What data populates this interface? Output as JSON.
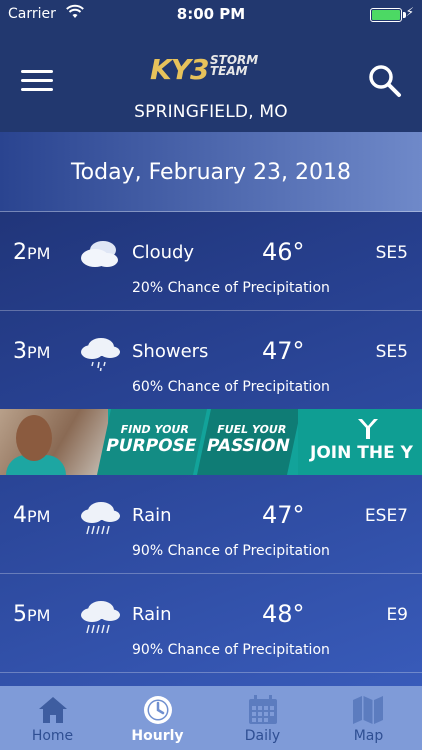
{
  "status_bar": {
    "carrier": "Carrier",
    "time": "8:00 PM"
  },
  "header": {
    "logo_ky3": "KY3",
    "logo_storm_team": "STORM TEAM",
    "location": "SPRINGFIELD, MO",
    "menu_icon": "hamburger-menu-icon",
    "search_icon": "magnifier-icon"
  },
  "date": "Today, February 23, 2018",
  "forecast": [
    {
      "hour": "2",
      "ampm": "PM",
      "icon": "cloudy-icon",
      "condition": "Cloudy",
      "temp": "46°",
      "wind": "SE5",
      "precip": "20% Chance of Precipitation"
    },
    {
      "hour": "3",
      "ampm": "PM",
      "icon": "showers-icon",
      "condition": "Showers",
      "temp": "47°",
      "wind": "SE5",
      "precip": "60% Chance of Precipitation"
    },
    {
      "hour": "4",
      "ampm": "PM",
      "icon": "rain-icon",
      "condition": "Rain",
      "temp": "47°",
      "wind": "ESE7",
      "precip": "90% Chance of Precipitation"
    },
    {
      "hour": "5",
      "ampm": "PM",
      "icon": "rain-icon",
      "condition": "Rain",
      "temp": "48°",
      "wind": "E9",
      "precip": "90% Chance of Precipitation"
    }
  ],
  "ad": {
    "seg1_small": "FIND YOUR",
    "seg1_big": "PURPOSE",
    "seg2_small": "FUEL YOUR",
    "seg2_big": "PASSION",
    "seg3": "JOIN THE Y"
  },
  "tabs": [
    {
      "label": "Home",
      "icon": "home-icon"
    },
    {
      "label": "Hourly",
      "icon": "clock-icon"
    },
    {
      "label": "Daily",
      "icon": "calendar-icon"
    },
    {
      "label": "Map",
      "icon": "map-icon"
    }
  ],
  "colors": {
    "accent_gold": "#e7c25b",
    "battery_green": "#4cd964",
    "tab_bar": "#7f9bd8",
    "ad_teal": "#12a39a"
  }
}
